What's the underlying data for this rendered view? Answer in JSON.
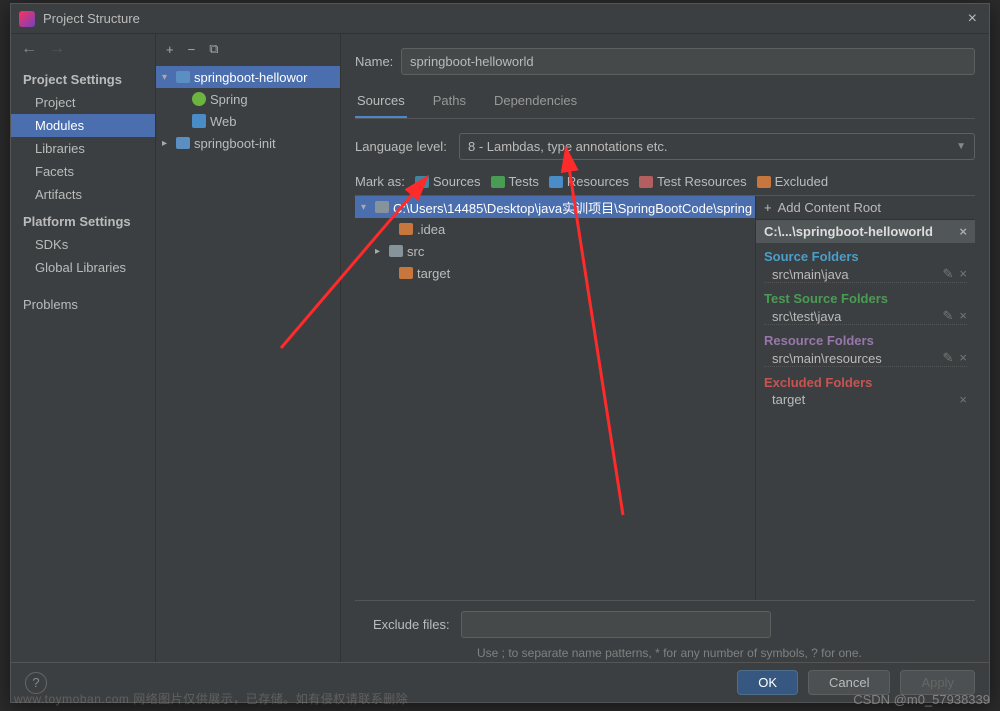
{
  "window": {
    "title": "Project Structure"
  },
  "nav": {
    "section1": "Project Settings",
    "items1": [
      "Project",
      "Modules",
      "Libraries",
      "Facets",
      "Artifacts"
    ],
    "section2": "Platform Settings",
    "items2": [
      "SDKs",
      "Global Libraries"
    ],
    "problems": "Problems"
  },
  "modules": {
    "root": "springboot-hellowor",
    "spring": "Spring",
    "web": "Web",
    "other": "springboot-init"
  },
  "form": {
    "nameLabel": "Name:",
    "nameValue": "springboot-helloworld",
    "tabs": [
      "Sources",
      "Paths",
      "Dependencies"
    ],
    "langLabel": "Language level:",
    "langValue": "8 - Lambdas, type annotations etc.",
    "markLabel": "Mark as:",
    "marks": {
      "sources": "Sources",
      "tests": "Tests",
      "resources": "Resources",
      "testres": "Test Resources",
      "excluded": "Excluded"
    }
  },
  "tree": {
    "root": "C:\\Users\\14485\\Desktop\\java实训项目\\SpringBootCode\\spring",
    "idea": ".idea",
    "src": "src",
    "target": "target"
  },
  "contentRoot": {
    "addLabel": "Add Content Root",
    "header": "C:\\...\\springboot-helloworld",
    "source": {
      "title": "Source Folders",
      "item": "src\\main\\java"
    },
    "test": {
      "title": "Test Source Folders",
      "item": "src\\test\\java"
    },
    "resource": {
      "title": "Resource Folders",
      "item": "src\\main\\resources"
    },
    "excluded": {
      "title": "Excluded Folders",
      "item": "target"
    }
  },
  "exclude": {
    "label": "Exclude files:",
    "hint": "Use ; to separate name patterns, * for any number of symbols, ? for one."
  },
  "footer": {
    "ok": "OK",
    "cancel": "Cancel",
    "apply": "Apply"
  },
  "watermark": "CSDN @m0_57938339",
  "watermark2": "www.toymoban.com  网络图片仅供展示，已存储。如有侵权请联系删除"
}
